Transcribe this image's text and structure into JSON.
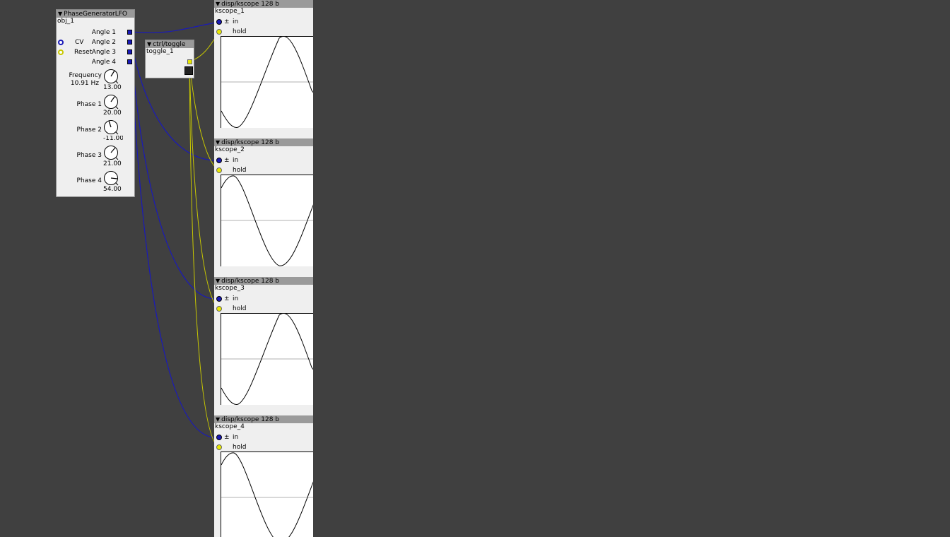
{
  "lfo": {
    "type": "PhaseGeneratorLFO",
    "instance": "obj_1",
    "outlets": [
      "Angle 1",
      "Angle 2",
      "Angle 3",
      "Angle 4"
    ],
    "inlets": [
      "CV",
      "Reset"
    ],
    "frequency": {
      "label": "Frequency",
      "readout": "10.91 Hz",
      "value": "13.00"
    },
    "phases": [
      {
        "label": "Phase 1",
        "value": "20.00"
      },
      {
        "label": "Phase 2",
        "value": "-11.00"
      },
      {
        "label": "Phase 3",
        "value": "21.00"
      },
      {
        "label": "Phase 4",
        "value": "54.00"
      }
    ]
  },
  "toggle": {
    "type": "ctrl/toggle",
    "instance": "toggle_1"
  },
  "scopes": [
    {
      "type": "disp/kscope 128 b",
      "instance": "kscope_1",
      "in_label": "in",
      "hold_label": "hold",
      "pm": "±"
    },
    {
      "type": "disp/kscope 128 b",
      "instance": "kscope_2",
      "in_label": "in",
      "hold_label": "hold",
      "pm": "±"
    },
    {
      "type": "disp/kscope 128 b",
      "instance": "kscope_3",
      "in_label": "in",
      "hold_label": "hold",
      "pm": "±"
    },
    {
      "type": "disp/kscope 128 b",
      "instance": "kscope_4",
      "in_label": "in",
      "hold_label": "hold",
      "pm": "±"
    }
  ],
  "colors": {
    "background": "#404040",
    "wire_frac32": "#1a1ab8",
    "wire_bool": "#c8c800",
    "header": "#9a9a9a",
    "body": "#efefef"
  }
}
